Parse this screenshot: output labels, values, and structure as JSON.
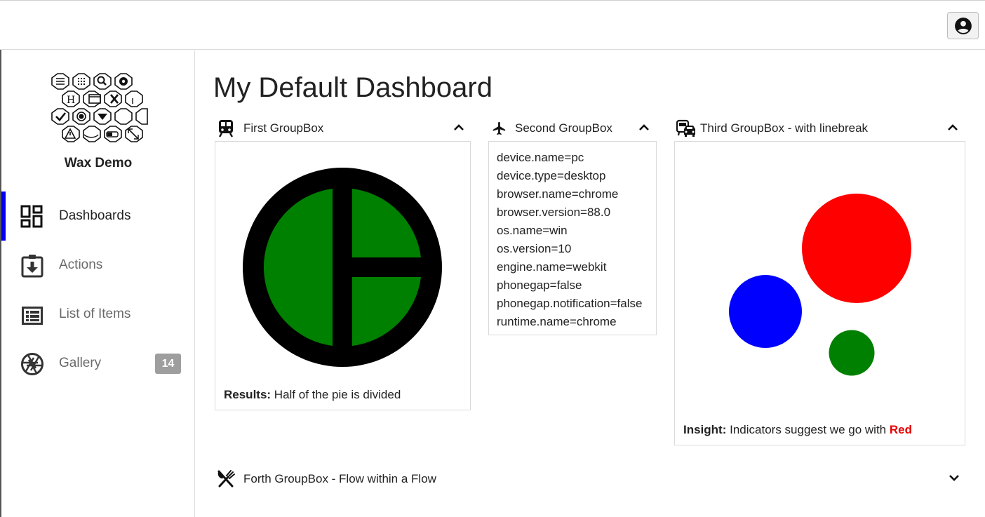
{
  "app": {
    "name": "Wax Demo",
    "logo_letter": "H"
  },
  "header": {
    "user_button_icon": "account-circle-icon"
  },
  "sidebar": {
    "items": [
      {
        "label": "Dashboards",
        "icon": "dashboard-icon",
        "active": true
      },
      {
        "label": "Actions",
        "icon": "clipboard-download-icon",
        "active": false
      },
      {
        "label": "List of Items",
        "icon": "list-icon",
        "active": false
      },
      {
        "label": "Gallery",
        "icon": "camera-aperture-icon",
        "active": false,
        "badge": "14"
      }
    ]
  },
  "main": {
    "title": "My Default Dashboard",
    "groupboxes": [
      {
        "title": "First GroupBox",
        "icon": "train-icon",
        "expanded": true,
        "caption_label": "Results:",
        "caption_text": " Half of the pie is divided"
      },
      {
        "title": "Second GroupBox",
        "icon": "airplane-icon",
        "expanded": true,
        "lines": [
          "device.name=pc",
          "device.type=desktop",
          "browser.name=chrome",
          "browser.version=88.0",
          "os.name=win",
          "os.version=10",
          "engine.name=webkit",
          "phonegap=false",
          "phonegap.notification=false",
          "runtime.name=chrome"
        ]
      },
      {
        "title": "Third GroupBox - with linebreak",
        "icon": "bus-car-icon",
        "expanded": true,
        "caption_label": "Insight:",
        "caption_text": " Indicators suggest we go with ",
        "caption_highlight": "Red"
      },
      {
        "title": "Forth GroupBox - Flow within a Flow",
        "icon": "fork-knife-icon",
        "expanded": false
      }
    ]
  },
  "colors": {
    "accent": "#0000ee",
    "pie_fill": "#008000",
    "bubble_red": "#ff0000",
    "bubble_blue": "#0000ff",
    "bubble_green": "#008000",
    "badge": "#9e9e9e",
    "highlight_red": "#e60000"
  }
}
